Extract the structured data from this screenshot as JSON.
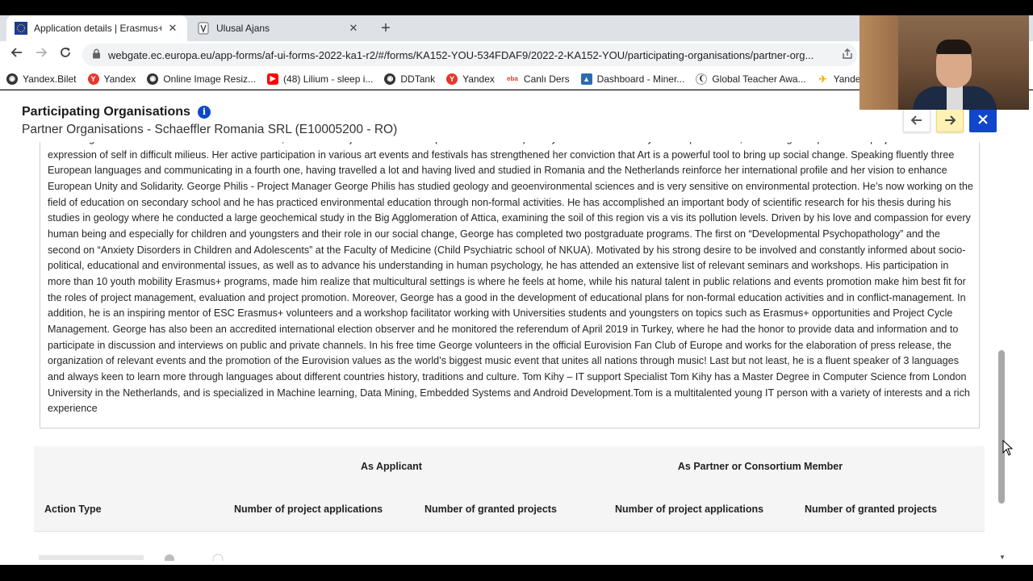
{
  "browser": {
    "tabs": [
      {
        "title": "Application details | Erasmus+ an",
        "favicon": "eu-flag-icon",
        "active": true
      },
      {
        "title": "Ulusal Ajans",
        "favicon": "ulusal-ajans-icon",
        "active": false
      }
    ],
    "new_tab": "+",
    "url": "webgate.ec.europa.eu/app-forms/af-ui-forms-2022-ka1-r2/#/forms/KA152-YOU-534FDAF9/2022-2-KA152-YOU/participating-organisations/partner-org...",
    "bookmarks": [
      {
        "label": "Yandex.Bilet",
        "icon": "globe-icon",
        "color": "#333333"
      },
      {
        "label": "Yandex",
        "icon": "yandex-icon",
        "color": "#e8372b"
      },
      {
        "label": "Online Image Resiz...",
        "icon": "globe-icon",
        "color": "#333333"
      },
      {
        "label": "(48) Lilium - sleep i...",
        "icon": "youtube-icon",
        "color": "#ff0000"
      },
      {
        "label": "DDTank",
        "icon": "globe-icon",
        "color": "#333333"
      },
      {
        "label": "Yandex",
        "icon": "yandex-icon",
        "color": "#e8372b"
      },
      {
        "label": "Canlı Ders",
        "icon": "eba-icon",
        "color": "#e23b2e"
      },
      {
        "label": "Dashboard - Miner...",
        "icon": "dashboard-icon",
        "color": "#2b6cb0"
      },
      {
        "label": "Global Teacher Awa...",
        "icon": "globe-icon",
        "color": "#333333"
      },
      {
        "label": "Yandex.Bilet",
        "icon": "plane-icon",
        "color": "#f4b400"
      }
    ]
  },
  "header": {
    "title": "Participating Organisations",
    "subtitle": "Partner Organisations - Schaeffler Romania SRL (E10005200 - RO)"
  },
  "description": {
    "text": "of the Region of Central Romania.   Last but not least, one of her major concerns is the power of Art and especially Dance as a tool for youth empowerment, combating xenophobia and prejudices and as an expression of self in difficult milieus. Her active participation in various art events and festivals has strengthened her conviction that Art is a powerful tool to bring up social change. Speaking fluently three European languages and communicating in a fourth one, having travelled a lot and having lived and studied in Romania and the Netherlands reinforce her international profile and her vision to enhance European Unity and Solidarity.  George Philis - Project Manager  George Philis has studied geology and geoenvironmental sciences and is very sensitive on environmental protection. He’s now working on the field of education on secondary school and he has practiced environmental education through non-formal activities. He has accomplished an important body of scientific research for his thesis during his studies in geology where he conducted a large geochemical study in the Big Agglomeration of Attica, examining the soil of this region vis a vis its pollution levels.    Driven by his love and compassion for every human being and especially for children and youngsters and their role in our social change, George has completed two postgraduate programs. The first on “Developmental Psychopathology” and the second on “Anxiety Disorders in Children and Adolescents” at the Faculty of Medicine (Child Psychiatric school of NKUA).  Motivated by his strong desire to be involved and constantly informed about socio-political, educational and environmental issues, as well as to advance his understanding in human psychology, he has attended an extensive list of relevant seminars and workshops.   His participation in more than 10 youth mobility Erasmus+ programs, made him realize that multicultural settings is where he feels at home, while his natural talent in public relations and events promotion make him best fit for the roles of project management, evaluation and project promotion. Moreover, George has a good in the development of educational plans for non-formal education activities and in conflict-management. In addition, he is an inspiring mentor of ESC Erasmus+ volunteers and a workshop facilitator working with Universities students and youngsters on topics such as Erasmus+ opportunities and Project Cycle Management.   George has also been an accredited international election observer and he monitored the referendum of April 2019 in Turkey, where he had the honor to provide data and information and to participate in discussion and interviews on public and private channels.   In his free time George volunteers in the official Eurovision Fan Club of Europe and works for the elaboration of press release, the organization of relevant events and the promotion of the Eurovision values as the world’s biggest music event that unites all nations through music! Last but not least, he is a fluent speaker of 3 languages and always keen to learn more through languages about different countries history, traditions and culture.  Tom Kihy – IT support Specialist  Tom Kihy has a Master Degree in Computer Science from London University in the Netherlands, and is specialized in Machine learning, Data Mining, Embedded Systems and Android Development.Tom is a multitalented young IT person with a variety of interests and a rich experience"
  },
  "table": {
    "group_applicant": "As Applicant",
    "group_partner": "As Partner or Consortium Member",
    "columns": [
      "Action Type",
      "Number of project applications",
      "Number of granted projects",
      "Number of project applications",
      "Number of granted projects"
    ]
  },
  "colors": {
    "accent": "#0e47cb",
    "next_button": "#fff2b3"
  }
}
